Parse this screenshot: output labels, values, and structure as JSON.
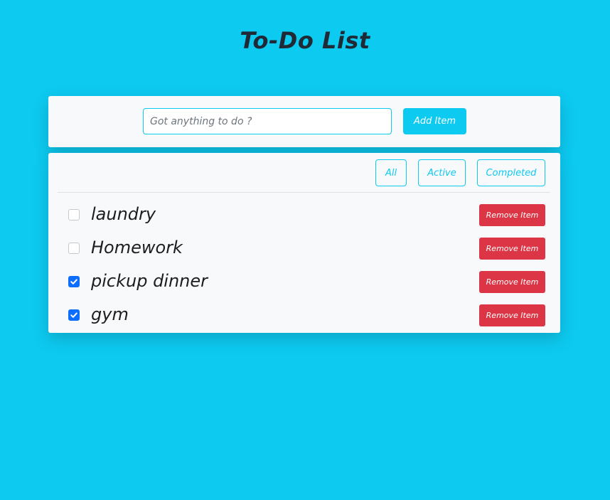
{
  "app": {
    "title": "To-Do List"
  },
  "add_form": {
    "input_value": "",
    "input_placeholder": "Got anything to do ?",
    "add_label": "Add Item"
  },
  "filters": {
    "all_label": "All",
    "active_label": "Active",
    "completed_label": "Completed"
  },
  "todos": [
    {
      "label": "laundry",
      "completed": false,
      "remove_label": "Remove Item"
    },
    {
      "label": "Homework",
      "completed": false,
      "remove_label": "Remove Item"
    },
    {
      "label": "pickup dinner",
      "completed": true,
      "remove_label": "Remove Item"
    },
    {
      "label": "gym",
      "completed": true,
      "remove_label": "Remove Item"
    }
  ],
  "colors": {
    "background": "#0dcaf0",
    "accent": "#0dcaf0",
    "danger": "#dc3545",
    "checked": "#0d6efd",
    "card": "#f8f9fa"
  }
}
